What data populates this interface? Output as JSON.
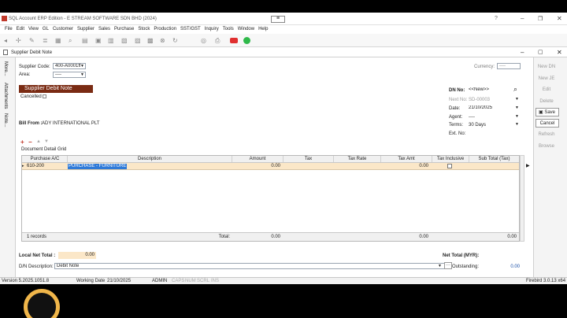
{
  "window": {
    "title": "SQL Account ERP Edition - E STREAM SOFTWARE SDN BHD (2024)"
  },
  "menu": {
    "items": [
      "File",
      "Edit",
      "View",
      "GL",
      "Customer",
      "Supplier",
      "Sales",
      "Purchase",
      "Stock",
      "Production",
      "SST/GST",
      "Inquiry",
      "Tools",
      "Window",
      "Help"
    ]
  },
  "doc": {
    "tab_title": "Supplier Debit Note",
    "badge": "Supplier Debit Note",
    "cancelled_label": "Cancelled",
    "supplier_code_label": "Supplier Code:",
    "supplier_code": "400-A0001ff",
    "area_label": "Area:",
    "area": "----",
    "currency_label": "Currency:",
    "currency": "----",
    "bill_from_label": "Bill From :",
    "bill_from": "ADY INTERNATIONAL PLT",
    "grid_label": "Document Detail Grid",
    "dn_no_label": "DN No:",
    "dn_no": "<<New>>",
    "next_no_label": "Next No:",
    "next_no": "SD-00003",
    "date_label": "Date:",
    "date": "21/10/2025",
    "agent_label": "Agent:",
    "agent": "----",
    "terms_label": "Terms:",
    "terms": "30 Days",
    "extno_label": "Ext. No:",
    "extno": ""
  },
  "side_tabs": [
    "More...",
    "Attachments",
    "Note..."
  ],
  "grid": {
    "headers": [
      "Purchase A/C",
      "Description",
      "Amount",
      "Tax",
      "Tax Rate",
      "Tax Amt",
      "Tax Inclusive",
      "Sub Total (Tax)"
    ],
    "row": {
      "account": "610-200",
      "description": "PURCHASE - FURNITURE",
      "amount": "0.00",
      "tax_amt": "0.00"
    },
    "footer": {
      "records": "1 records",
      "total_label": "Total:",
      "amount": "0.00",
      "tax_amt": "0.00",
      "subtotal": "0.00"
    }
  },
  "totals": {
    "local_net_label": "Local Net Total :",
    "local_net": "0.00",
    "net_total_label": "Net Total (MYR):",
    "net_total": "",
    "dn_desc_label": "D/N Description:",
    "dn_desc": "Debit Note",
    "outstanding_label": "Outstanding:",
    "outstanding": "0.00"
  },
  "right_buttons": {
    "new_dn": "New DN",
    "new_je": "New JE",
    "edit": "Edit",
    "delete": "Delete",
    "save": "Save",
    "cancel": "Cancel",
    "refresh": "Refresh",
    "browse": "Browse"
  },
  "status": {
    "version": "Version 5.2025.1051.8",
    "working_date_label": "Working Date",
    "working_date": "21/10/2025",
    "user": "ADMIN",
    "caps": "CAPS",
    "num": "NUM",
    "scrl": "SCRL",
    "ins": "INS",
    "firebird": "Firebird 3.0.13 x64"
  },
  "colors": {
    "badge_bg": "#7a2b13",
    "row_highlight": "#fbe7c8",
    "selection": "#2f7ad8"
  }
}
